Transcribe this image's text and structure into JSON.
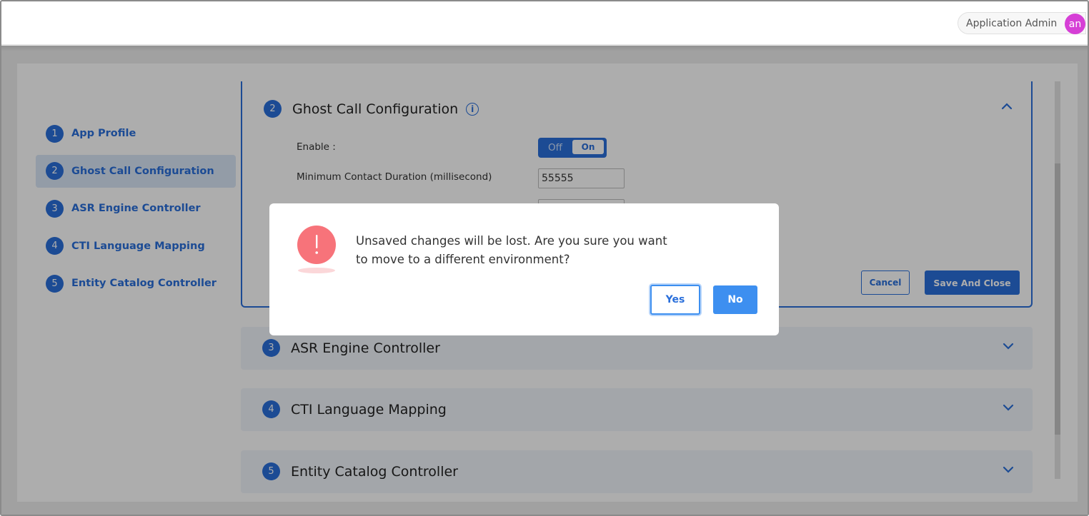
{
  "header": {
    "user_name": "Application Admin",
    "avatar_initials": "an",
    "avatar_color": "#d63fd6"
  },
  "sidebar": {
    "items": [
      {
        "num": "1",
        "label": "App Profile",
        "active": false
      },
      {
        "num": "2",
        "label": "Ghost Call Configuration",
        "active": true
      },
      {
        "num": "3",
        "label": "ASR Engine Controller",
        "active": false
      },
      {
        "num": "4",
        "label": "CTI Language Mapping",
        "active": false
      },
      {
        "num": "5",
        "label": "Entity Catalog Controller",
        "active": false
      }
    ]
  },
  "ghost_call": {
    "num": "2",
    "title": "Ghost Call Configuration",
    "info_icon": "info-icon",
    "enable_label": "Enable :",
    "toggle_off_label": "Off",
    "toggle_on_label": "On",
    "min_duration_label": "Minimum Contact Duration (millisecond)",
    "min_duration_value": "55555",
    "second_field_value": "",
    "cancel_label": "Cancel",
    "save_label": "Save And Close"
  },
  "sections": [
    {
      "num": "3",
      "title": "ASR Engine Controller"
    },
    {
      "num": "4",
      "title": "CTI Language Mapping"
    },
    {
      "num": "5",
      "title": "Entity Catalog Controller"
    }
  ],
  "dialog": {
    "icon": "exclamation-icon",
    "message_line1": "Unsaved changes will be lost. Are you sure you want",
    "message_line2": "to move to a different environment?",
    "yes_label": "Yes",
    "no_label": "No"
  },
  "colors": {
    "accent": "#2a6fdb",
    "button_blue": "#3d8ff0",
    "alert": "#f7737a"
  }
}
